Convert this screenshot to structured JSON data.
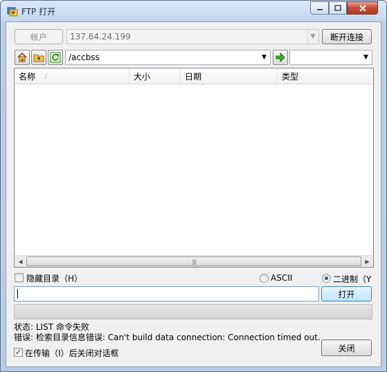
{
  "window": {
    "title": "FTP 打开"
  },
  "account": {
    "label": "帐户",
    "host": "137.64.24.199",
    "disconnect_label": "断开连接"
  },
  "toolbar": {
    "path": "/accbss",
    "icons": [
      "home-icon",
      "parent-folder-icon",
      "refresh-icon",
      "go-arrow-icon"
    ]
  },
  "file_list": {
    "columns": [
      "名称",
      "大小",
      "日期",
      "类型"
    ],
    "sort_indicator": "/",
    "rows": []
  },
  "options": {
    "hide_dirs_label": "隐藏目录（H）",
    "hide_dirs_checked": false,
    "ascii_label": "ASCII",
    "ascii_underline": "S",
    "binary_label": "二进制（Y",
    "transfer_mode": "binary"
  },
  "filename": {
    "value": "",
    "open_label": "打开"
  },
  "status": {
    "line1": "状态: LIST 命令失败",
    "line2": "错误: 检索目录信息错误: Can't build data connection: Connection timed out."
  },
  "footer": {
    "close_after_label": "在传输（I）后关闭对话框",
    "close_after_checked": true,
    "close_label": "关闭"
  },
  "colors": {
    "title_bar": "#c9dcf2",
    "dialog_bg": "#f0f0f0",
    "close_button": "#c64a36"
  }
}
